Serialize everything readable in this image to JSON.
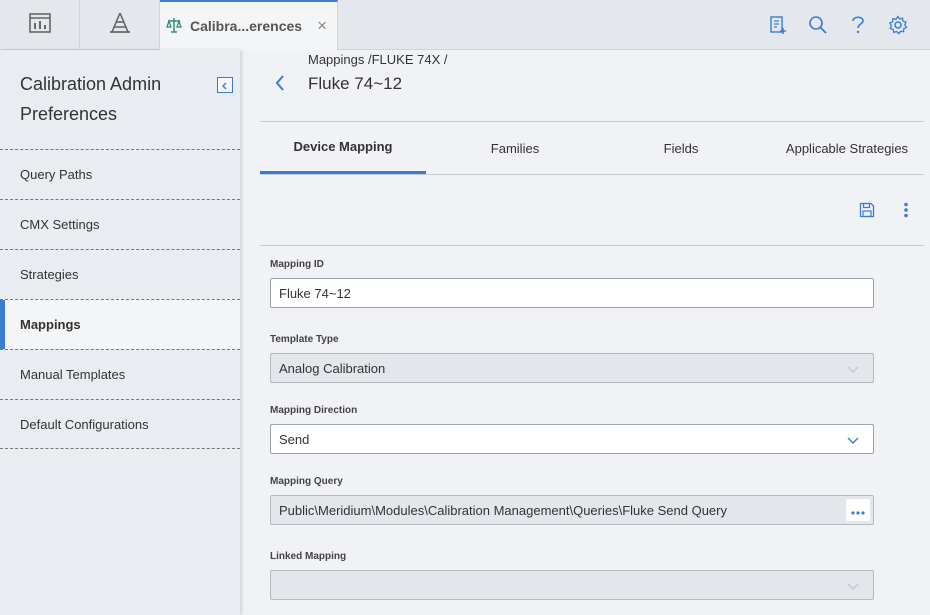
{
  "topbar": {
    "buttons": [
      {
        "icon": "dashboard-icon"
      },
      {
        "icon": "tower-icon"
      }
    ],
    "active_tab": {
      "icon": "scales-icon",
      "label": "Calibra...erences",
      "close_label": "×"
    },
    "right_icons": [
      "new-document-icon",
      "search-icon",
      "help-icon",
      "gear-icon"
    ],
    "accent_color": "#3a7dd1"
  },
  "sidebar": {
    "title": "Calibration Admin Preferences",
    "items": [
      {
        "label": "Query Paths",
        "active": false
      },
      {
        "label": "CMX Settings",
        "active": false
      },
      {
        "label": "Strategies",
        "active": false
      },
      {
        "label": "Mappings",
        "active": true
      },
      {
        "label": "Manual Templates",
        "active": false
      },
      {
        "label": "Default Configurations",
        "active": false
      }
    ]
  },
  "main": {
    "breadcrumb": "Mappings /FLUKE 74X /",
    "title": "Fluke 74~12",
    "tabs": [
      {
        "label": "Device Mapping",
        "active": true
      },
      {
        "label": "Families",
        "active": false
      },
      {
        "label": "Fields",
        "active": false
      },
      {
        "label": "Applicable Strategies",
        "active": false
      }
    ],
    "actions": [
      "save-icon",
      "more-vertical-icon"
    ],
    "form": {
      "mapping_id": {
        "label": "Mapping ID",
        "value": "Fluke 74~12"
      },
      "template_type": {
        "label": "Template Type",
        "value": "Analog Calibration"
      },
      "mapping_direction": {
        "label": "Mapping Direction",
        "value": "Send"
      },
      "mapping_query": {
        "label": "Mapping Query",
        "value": "Public\\Meridium\\Modules\\Calibration Management\\Queries\\Fluke Send Query"
      },
      "linked_mapping": {
        "label": "Linked Mapping",
        "value": ""
      }
    }
  }
}
